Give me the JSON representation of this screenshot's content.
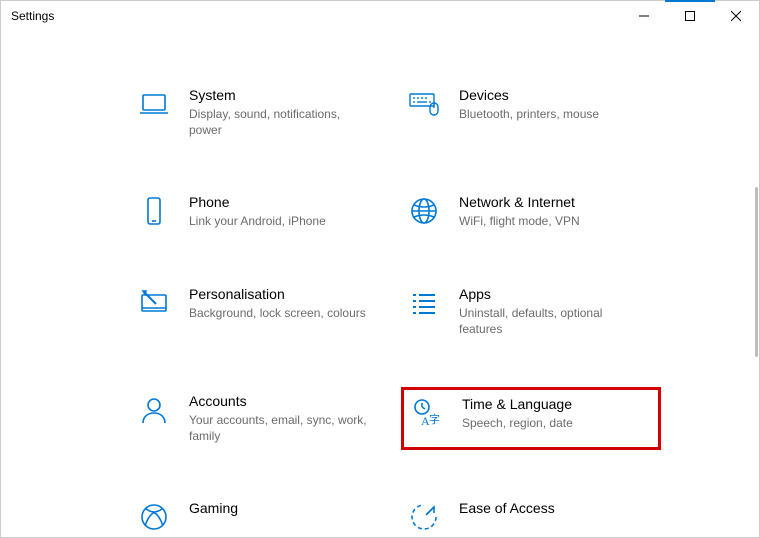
{
  "window": {
    "title": "Settings"
  },
  "categories": [
    {
      "id": "system",
      "label": "System",
      "desc": "Display, sound, notifications, power",
      "icon": "laptop-icon"
    },
    {
      "id": "devices",
      "label": "Devices",
      "desc": "Bluetooth, printers, mouse",
      "icon": "keyboard-mouse-icon"
    },
    {
      "id": "phone",
      "label": "Phone",
      "desc": "Link your Android, iPhone",
      "icon": "phone-icon"
    },
    {
      "id": "network",
      "label": "Network & Internet",
      "desc": "WiFi, flight mode, VPN",
      "icon": "globe-icon"
    },
    {
      "id": "personalisation",
      "label": "Personalisation",
      "desc": "Background, lock screen, colours",
      "icon": "pen-monitor-icon"
    },
    {
      "id": "apps",
      "label": "Apps",
      "desc": "Uninstall, defaults, optional features",
      "icon": "list-icon"
    },
    {
      "id": "accounts",
      "label": "Accounts",
      "desc": "Your accounts, email, sync, work, family",
      "icon": "person-icon"
    },
    {
      "id": "time-language",
      "label": "Time & Language",
      "desc": "Speech, region, date",
      "icon": "time-language-icon",
      "highlighted": true
    },
    {
      "id": "gaming",
      "label": "Gaming",
      "desc": "",
      "icon": "xbox-icon"
    },
    {
      "id": "ease-of-access",
      "label": "Ease of Access",
      "desc": "",
      "icon": "ease-of-access-icon"
    }
  ],
  "colors": {
    "accent": "#0078d4",
    "highlight_border": "#d20000",
    "desc_text": "#6b6b6b"
  }
}
